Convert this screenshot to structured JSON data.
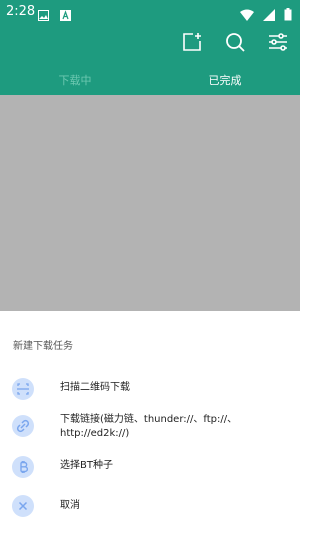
{
  "status": {
    "time": "2:28",
    "left_icons": [
      "image-notification-icon",
      "app-notification-icon"
    ],
    "right_icons": [
      "wifi-icon",
      "signal-icon",
      "battery-icon"
    ]
  },
  "toolbar": {
    "icons": [
      "add-task-icon",
      "search-icon",
      "filter-icon"
    ]
  },
  "tabs": [
    {
      "label": "下载中"
    },
    {
      "label": "已完成"
    }
  ],
  "sheet": {
    "title": "新建下载任务",
    "items": [
      {
        "label": "扫描二维码下载",
        "icon": "scan-icon"
      },
      {
        "label": "下载链接(磁力链、thunder://、ftp://、http://ed2k://)",
        "icon": "link-icon"
      },
      {
        "label": "选择BT种子",
        "icon": "bitcoin-icon"
      },
      {
        "label": "取消",
        "icon": "close-icon"
      }
    ]
  },
  "colors": {
    "primary": "#1e9b7f",
    "dim_overlay": "#b3b3b3",
    "icon_bg": "#cfe0fb",
    "icon_fg": "#7aa6ee"
  }
}
